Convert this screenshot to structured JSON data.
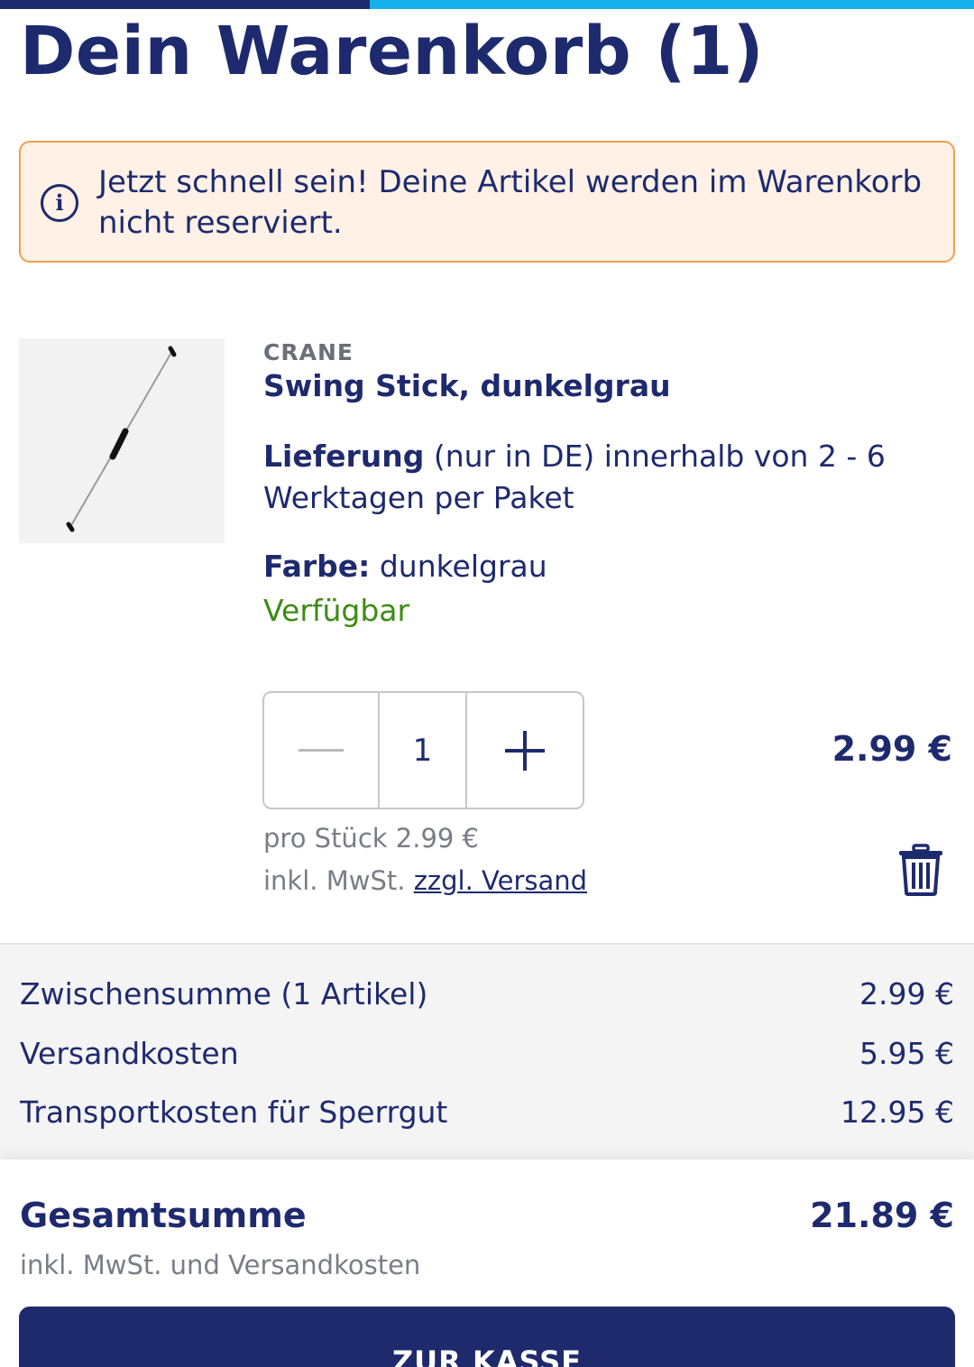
{
  "progress": {
    "fraction": 0.38
  },
  "header": {
    "title": "Dein Warenkorb (1)"
  },
  "notice": {
    "icon": "info-icon",
    "text": "Jetzt schnell sein! Deine Artikel werden im Warenkorb nicht reserviert."
  },
  "item": {
    "brand": "CRANE",
    "name": "Swing Stick, dunkelgrau",
    "delivery_label": "Lieferung",
    "delivery_text": " (nur in DE) innerhalb von 2 - 6 Werktagen per Paket",
    "color_label": "Farbe:",
    "color_value": " dunkelgrau",
    "availability": "Verfügbar",
    "quantity": "1",
    "price": "2.99 €",
    "unit_price": "pro Stück 2.99 €",
    "tax_text": "inkl. MwSt. ",
    "shipping_link": "zzgl. Versand"
  },
  "summary": {
    "rows": [
      {
        "label": "Zwischensumme  (1 Artikel)",
        "value": "2.99 €"
      },
      {
        "label": "Versandkosten",
        "value": "5.95 €"
      },
      {
        "label": "Transportkosten für Sperrgut",
        "value": "12.95 €"
      }
    ]
  },
  "total": {
    "label": "Gesamtsumme",
    "value": "21.89 €",
    "note": "inkl. MwSt. und Versandkosten"
  },
  "checkout": {
    "label": "ZUR KASSE"
  },
  "colors": {
    "navy": "#1e2a6e",
    "accent_blue": "#16b1ea",
    "notice_bg": "#fff1e6",
    "notice_border": "#f0a04b",
    "available_green": "#3d8b14"
  }
}
